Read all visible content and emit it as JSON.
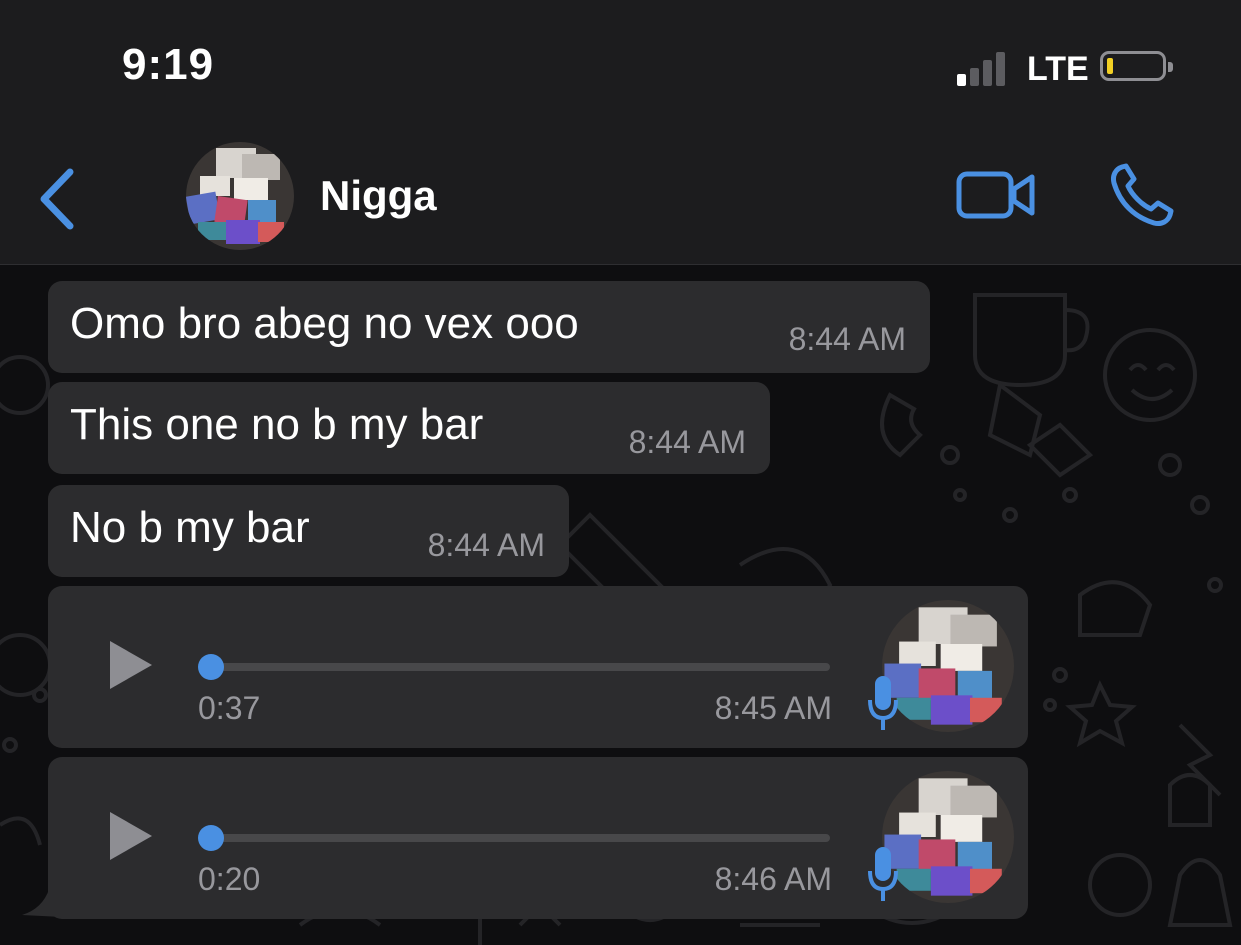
{
  "status": {
    "time": "9:19",
    "network": "LTE",
    "signal_bars": 1,
    "battery_level": 0.1
  },
  "header": {
    "contact_name": "Nigga"
  },
  "messages": [
    {
      "text": "Omo bro abeg no vex ooo",
      "time": "8:44 AM"
    },
    {
      "text": "This one no b my bar",
      "time": "8:44 AM"
    },
    {
      "text": "No b my bar",
      "time": "8:44 AM"
    }
  ],
  "voice_notes": [
    {
      "duration": "0:37",
      "time": "8:45 AM",
      "progress": 0
    },
    {
      "duration": "0:20",
      "time": "8:46 AM",
      "progress": 0
    }
  ],
  "colors": {
    "accent": "#4a90e2",
    "bubble": "#2c2c2e",
    "bar": "#1c1c1e",
    "battery": "#f2d024"
  },
  "icons": [
    "back-chevron-icon",
    "video-call-icon",
    "voice-call-icon",
    "play-icon",
    "microphone-icon"
  ]
}
